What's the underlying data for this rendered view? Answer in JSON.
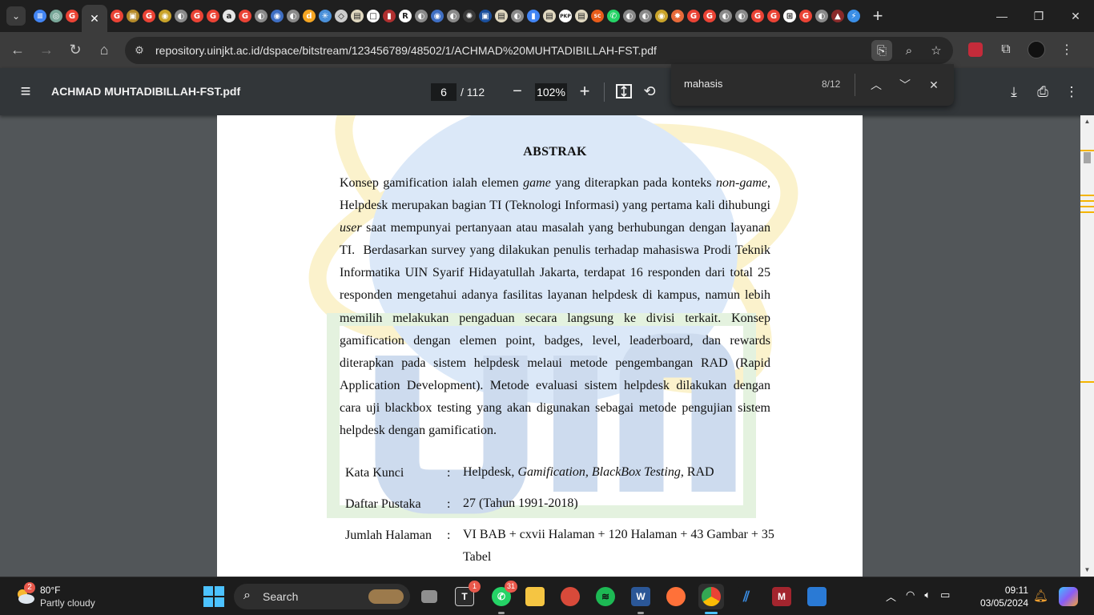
{
  "browser": {
    "tab_favicons": [
      {
        "name": "docs",
        "color": "#4285f4",
        "glyph": "≡"
      },
      {
        "name": "openai",
        "color": "#7aa89a",
        "glyph": "◎"
      },
      {
        "name": "google",
        "color": "#ea4335",
        "glyph": "G"
      }
    ],
    "active_tab_close": "✕",
    "more_favicons": [
      {
        "name": "google",
        "color": "#ea4335",
        "glyph": "G"
      },
      {
        "name": "site",
        "color": "#b58a2a",
        "glyph": "▣"
      },
      {
        "name": "google",
        "color": "#ea4335",
        "glyph": "G"
      },
      {
        "name": "site",
        "color": "#c9a32a",
        "glyph": "◉"
      },
      {
        "name": "site",
        "color": "#8a8a8a",
        "glyph": "◐"
      },
      {
        "name": "google",
        "color": "#ea4335",
        "glyph": "G"
      },
      {
        "name": "google",
        "color": "#ea4335",
        "glyph": "G"
      },
      {
        "name": "amazon",
        "color": "#e6e6e6",
        "glyph": "a"
      },
      {
        "name": "google",
        "color": "#ea4335",
        "glyph": "G"
      },
      {
        "name": "site",
        "color": "#8a8a8a",
        "glyph": "◐"
      },
      {
        "name": "site",
        "color": "#3f6fc4",
        "glyph": "◉"
      },
      {
        "name": "site",
        "color": "#8a8a8a",
        "glyph": "◐"
      },
      {
        "name": "site",
        "color": "#f5a623",
        "glyph": "d"
      },
      {
        "name": "site",
        "color": "#4a90d9",
        "glyph": "✳"
      },
      {
        "name": "site",
        "color": "#cccccc",
        "glyph": "◇"
      },
      {
        "name": "site",
        "color": "#e0d8c0",
        "glyph": "▤"
      },
      {
        "name": "site",
        "color": "#ffffff",
        "glyph": "□"
      },
      {
        "name": "site",
        "color": "#b03030",
        "glyph": "▮"
      },
      {
        "name": "researchgate",
        "color": "#ffffff",
        "glyph": "R"
      },
      {
        "name": "site",
        "color": "#8a8a8a",
        "glyph": "◐"
      },
      {
        "name": "site",
        "color": "#3f6fc4",
        "glyph": "◉"
      },
      {
        "name": "site",
        "color": "#8a8a8a",
        "glyph": "◐"
      },
      {
        "name": "site",
        "color": "#3a3a3a",
        "glyph": "✺"
      },
      {
        "name": "site",
        "color": "#1a4f9c",
        "glyph": "▣"
      },
      {
        "name": "site",
        "color": "#e0d8c0",
        "glyph": "▤"
      },
      {
        "name": "site",
        "color": "#8a8a8a",
        "glyph": "◐"
      },
      {
        "name": "site",
        "color": "#4285f4",
        "glyph": "▮"
      },
      {
        "name": "site",
        "color": "#e0d8c0",
        "glyph": "▤"
      },
      {
        "name": "site",
        "color": "#ffffff",
        "glyph": "PKP"
      },
      {
        "name": "site",
        "color": "#e0d8c0",
        "glyph": "▤"
      },
      {
        "name": "site",
        "color": "#e85c1a",
        "glyph": "SC"
      },
      {
        "name": "whatsapp",
        "color": "#25d366",
        "glyph": "✆"
      },
      {
        "name": "site",
        "color": "#8a8a8a",
        "glyph": "◐"
      },
      {
        "name": "site",
        "color": "#8a8a8a",
        "glyph": "◐"
      },
      {
        "name": "site",
        "color": "#c9a32a",
        "glyph": "◉"
      },
      {
        "name": "site",
        "color": "#e86a3a",
        "glyph": "✸"
      },
      {
        "name": "google",
        "color": "#ea4335",
        "glyph": "G"
      },
      {
        "name": "google",
        "color": "#ea4335",
        "glyph": "G"
      },
      {
        "name": "site",
        "color": "#8a8a8a",
        "glyph": "◐"
      },
      {
        "name": "site",
        "color": "#8a8a8a",
        "glyph": "◐"
      },
      {
        "name": "google",
        "color": "#ea4335",
        "glyph": "G"
      },
      {
        "name": "google",
        "color": "#ea4335",
        "glyph": "G"
      },
      {
        "name": "site",
        "color": "#ffffff",
        "glyph": "⊞"
      },
      {
        "name": "google",
        "color": "#ea4335",
        "glyph": "G"
      },
      {
        "name": "site",
        "color": "#8a8a8a",
        "glyph": "◐"
      },
      {
        "name": "site",
        "color": "#8a2a2a",
        "glyph": "▲"
      },
      {
        "name": "site",
        "color": "#3a8ee6",
        "glyph": "⚡"
      }
    ],
    "new_tab": "+",
    "url": "repository.uinjkt.ac.id/dspace/bitstream/123456789/48502/1/ACHMAD%20MUHTADIBILLAH-FST.pdf"
  },
  "pdf_viewer": {
    "file_name": "ACHMAD MUHTADIBILLAH-FST.pdf",
    "current_page": "6",
    "total_pages": "/ 112",
    "zoom": "102%"
  },
  "find_bar": {
    "query": "mahasis",
    "count": "8/12"
  },
  "document": {
    "heading": "ABSTRAK",
    "keywords_label": "Kata Kunci",
    "bibliography_label": "Daftar Pustaka",
    "bibliography_value": "27 (Tahun 1991-2018)",
    "pages_label": "Jumlah Halaman",
    "pages_value": "VI BAB + cxvii Halaman + 120 Halaman + 43 Gambar + 35 Tabel",
    "colon": ":"
  },
  "taskbar": {
    "weather_badge": "2",
    "temperature": "80°F",
    "condition": "Partly cloudy",
    "search_label": "Search",
    "teams_badge": "1",
    "whatsapp_badge": "31",
    "time": "09:11",
    "date": "03/05/2024"
  }
}
